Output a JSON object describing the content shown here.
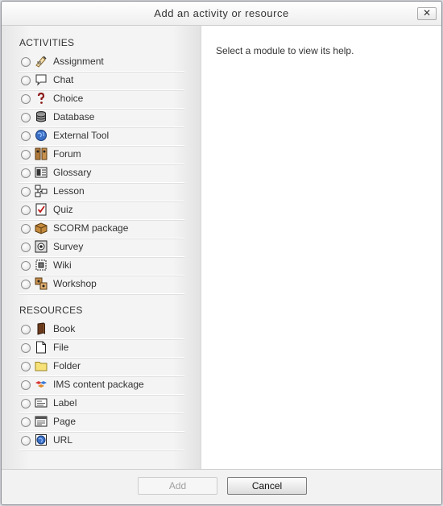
{
  "dialog": {
    "title": "Add an activity or resource",
    "close_label": "✕",
    "help_text": "Select a module to view its help."
  },
  "activities": {
    "heading": "ACTIVITIES",
    "items": [
      {
        "label": "Assignment",
        "icon": "assignment-icon"
      },
      {
        "label": "Chat",
        "icon": "chat-icon"
      },
      {
        "label": "Choice",
        "icon": "choice-icon"
      },
      {
        "label": "Database",
        "icon": "database-icon"
      },
      {
        "label": "External Tool",
        "icon": "external-tool-icon"
      },
      {
        "label": "Forum",
        "icon": "forum-icon"
      },
      {
        "label": "Glossary",
        "icon": "glossary-icon"
      },
      {
        "label": "Lesson",
        "icon": "lesson-icon"
      },
      {
        "label": "Quiz",
        "icon": "quiz-icon"
      },
      {
        "label": "SCORM package",
        "icon": "scorm-package-icon"
      },
      {
        "label": "Survey",
        "icon": "survey-icon"
      },
      {
        "label": "Wiki",
        "icon": "wiki-icon"
      },
      {
        "label": "Workshop",
        "icon": "workshop-icon"
      }
    ]
  },
  "resources": {
    "heading": "RESOURCES",
    "items": [
      {
        "label": "Book",
        "icon": "book-icon"
      },
      {
        "label": "File",
        "icon": "file-icon"
      },
      {
        "label": "Folder",
        "icon": "folder-icon"
      },
      {
        "label": "IMS content package",
        "icon": "ims-content-package-icon"
      },
      {
        "label": "Label",
        "icon": "label-icon"
      },
      {
        "label": "Page",
        "icon": "page-icon"
      },
      {
        "label": "URL",
        "icon": "url-icon"
      }
    ]
  },
  "footer": {
    "add_label": "Add",
    "cancel_label": "Cancel"
  }
}
